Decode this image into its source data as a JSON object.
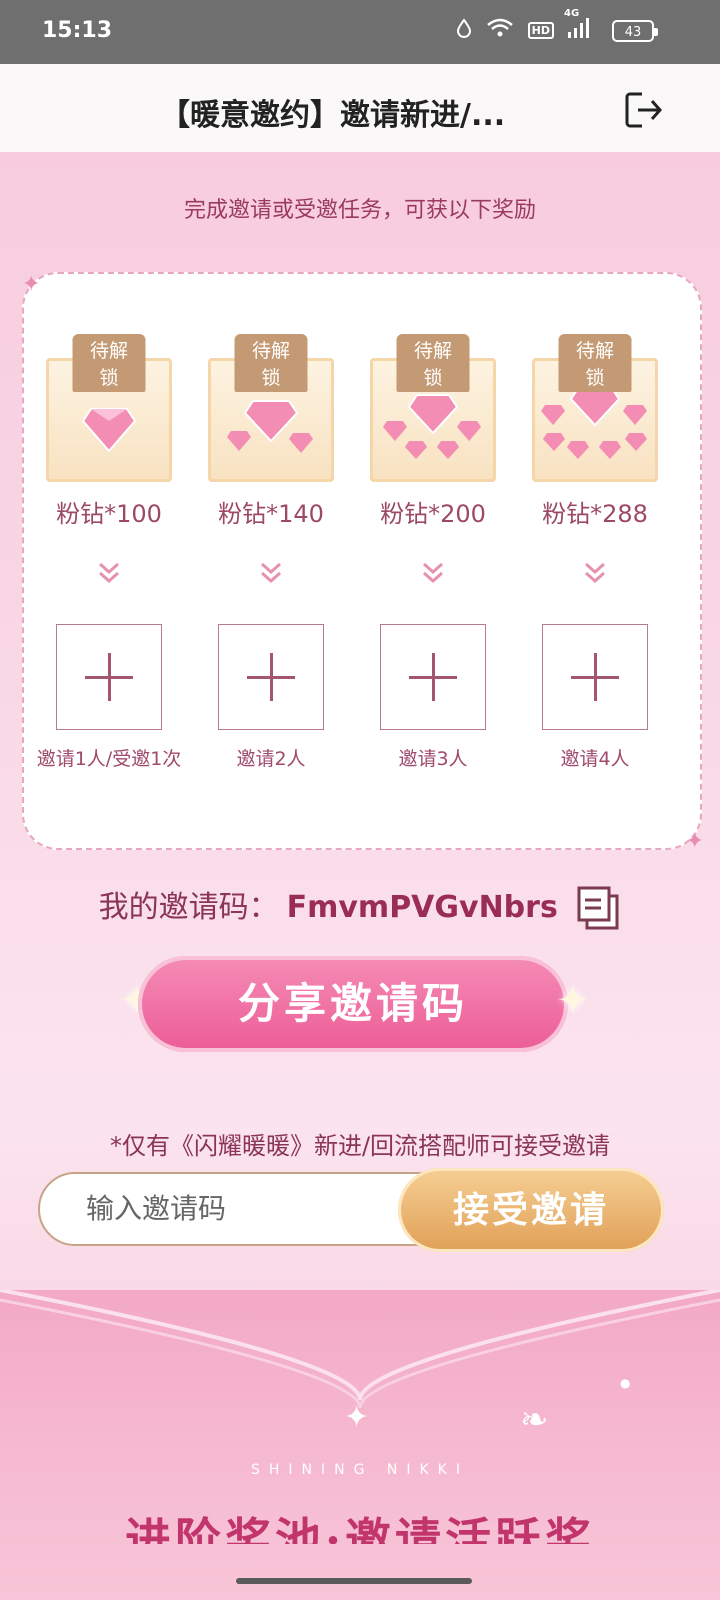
{
  "status_bar": {
    "time": "15:13",
    "network": "4G",
    "hd": "HD",
    "battery": "43"
  },
  "header": {
    "title": "【暖意邀约】邀请新进/..."
  },
  "panel": {
    "subtitle": "完成邀请或受邀任务，可获以下奖励",
    "rewards": [
      {
        "badge": "待解锁",
        "label": "粉钻*100",
        "task": "邀请1人/受邀1次"
      },
      {
        "badge": "待解锁",
        "label": "粉钻*140",
        "task": "邀请2人"
      },
      {
        "badge": "待解锁",
        "label": "粉钻*200",
        "task": "邀请3人"
      },
      {
        "badge": "待解锁",
        "label": "粉钻*288",
        "task": "邀请4人"
      }
    ]
  },
  "invite": {
    "label": "我的邀请码：",
    "code": "FmvmPVGvNbrs",
    "share_button": "分享邀请码",
    "notice": "*仅有《闪耀暖暖》新进/回流搭配师可接受邀请",
    "input_placeholder": "输入邀请码",
    "accept_button": "接受邀请"
  },
  "banner": {
    "brand": "SHINING NIKKI",
    "title": "进阶奖池·邀请活跃奖"
  },
  "colors": {
    "accent": "#ec5c96",
    "gold": "#e0a057",
    "text": "#9a3a5e"
  }
}
